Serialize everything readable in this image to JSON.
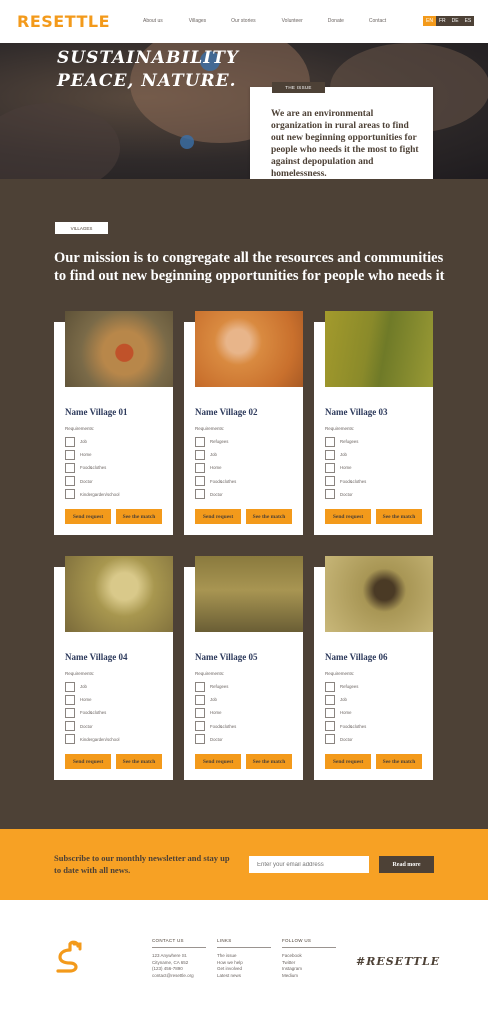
{
  "brand": {
    "logo_text": "RESETTLE",
    "accent_color": "#f39a1b",
    "dark_color": "#4d4136"
  },
  "nav": {
    "items": [
      "About us",
      "Villages",
      "Our stories",
      "Volunteer",
      "Donate",
      "Contact"
    ]
  },
  "languages": {
    "items": [
      "EN",
      "FR",
      "DE",
      "ES"
    ],
    "active": "EN"
  },
  "hero": {
    "title_line1": "SUSTAINABILITY",
    "title_line2": "PEACE, NATURE.",
    "issue_tag": "THE ISSUE",
    "issue_text": "We are an environmental organization in rural areas to find out new beginning opportunities for people who needs it the most to fight against depopulation and homelessness."
  },
  "mission": {
    "tag": "VILLAGES",
    "title": "Our mission is to congregate all the resources and communities to find out new beginning opportunities for people who needs it"
  },
  "villages": [
    {
      "name": "Name Village 01",
      "requirements_label": "Requirements:",
      "requirements": [
        "Job",
        "Home",
        "Food&clothes",
        "Doctor",
        "Kindergarden/school"
      ],
      "send_label": "Send request",
      "match_label": "See the match"
    },
    {
      "name": "Name Village 02",
      "requirements_label": "Requirements:",
      "requirements": [
        "Refugees",
        "Job",
        "Home",
        "Food&clothes",
        "Doctor"
      ],
      "send_label": "Send request",
      "match_label": "See the match"
    },
    {
      "name": "Name Village 03",
      "requirements_label": "Requirements:",
      "requirements": [
        "Refugees",
        "Job",
        "Home",
        "Food&clothes",
        "Doctor"
      ],
      "send_label": "Send request",
      "match_label": "See the match"
    },
    {
      "name": "Name Village 04",
      "requirements_label": "Requirements:",
      "requirements": [
        "Job",
        "Home",
        "Food&clothes",
        "Doctor",
        "Kindergarden/school"
      ],
      "send_label": "Send request",
      "match_label": "See the match"
    },
    {
      "name": "Name Village 05",
      "requirements_label": "Requirements:",
      "requirements": [
        "Refugees",
        "Job",
        "Home",
        "Food&clothes",
        "Doctor"
      ],
      "send_label": "Send request",
      "match_label": "See the match"
    },
    {
      "name": "Name Village 06",
      "requirements_label": "Requirements:",
      "requirements": [
        "Refugees",
        "Job",
        "Home",
        "Food&clothes",
        "Doctor"
      ],
      "send_label": "Send request",
      "match_label": "See the match"
    }
  ],
  "newsletter": {
    "text": "Subscribe to our monthly newsletter and stay up to date with all news.",
    "placeholder": "Enter your email address",
    "button_label": "Read more"
  },
  "footer": {
    "contact": {
      "heading": "CONTACT US",
      "lines": [
        "123 Anywhere St.",
        "Cityname, CA 652",
        "(123) 456-7890",
        "contact@resettle.org"
      ]
    },
    "links": {
      "heading": "LINKS",
      "lines": [
        "The issue",
        "How we help",
        "Get involved",
        "Latest news"
      ]
    },
    "follow": {
      "heading": "FOLLOW US",
      "lines": [
        "Facebook",
        "Twitter",
        "Instagram",
        "Medium"
      ]
    },
    "hashtag": "#RESETTLE"
  }
}
